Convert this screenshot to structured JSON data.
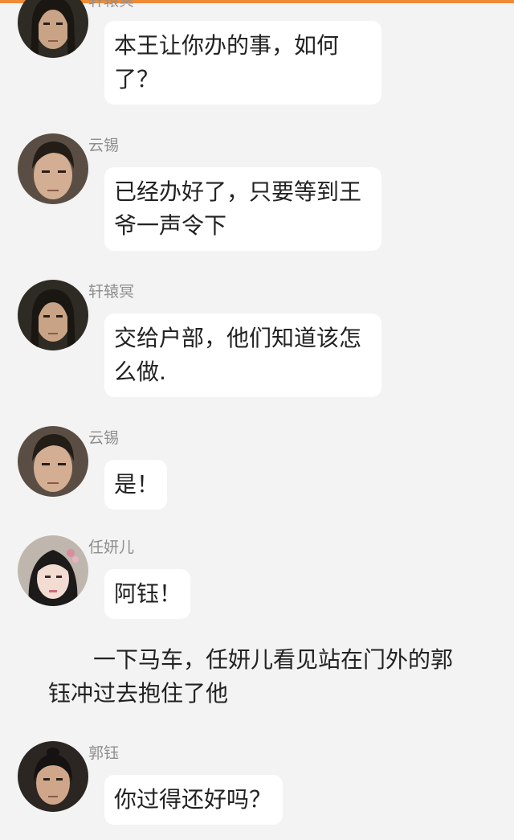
{
  "messages": [
    {
      "speaker": "轩辕冥",
      "lines": [
        "本王让你办的事，如何",
        "了？"
      ]
    },
    {
      "speaker": "云锡",
      "lines": [
        "已经办好了，只要等到王",
        "爷一声令下"
      ]
    },
    {
      "speaker": "轩辕冥",
      "lines": [
        "交给户部，他们知道该怎",
        "么做."
      ]
    },
    {
      "speaker": "云锡",
      "lines": [
        "是！"
      ]
    },
    {
      "speaker": "任妍儿",
      "lines": [
        "阿钰！"
      ]
    },
    {
      "speaker": "郭钰",
      "lines": [
        "你过得还好吗？"
      ]
    }
  ],
  "narration": {
    "line1": "一下马车，任妍儿看见站在门外的郭",
    "line2": "钰冲过去抱住了他"
  },
  "colors": {
    "accent_bar": "#f08a35",
    "background": "#f3f3f3",
    "bubble": "#ffffff",
    "name_text": "#8e8e8e",
    "message_text": "#222222"
  }
}
